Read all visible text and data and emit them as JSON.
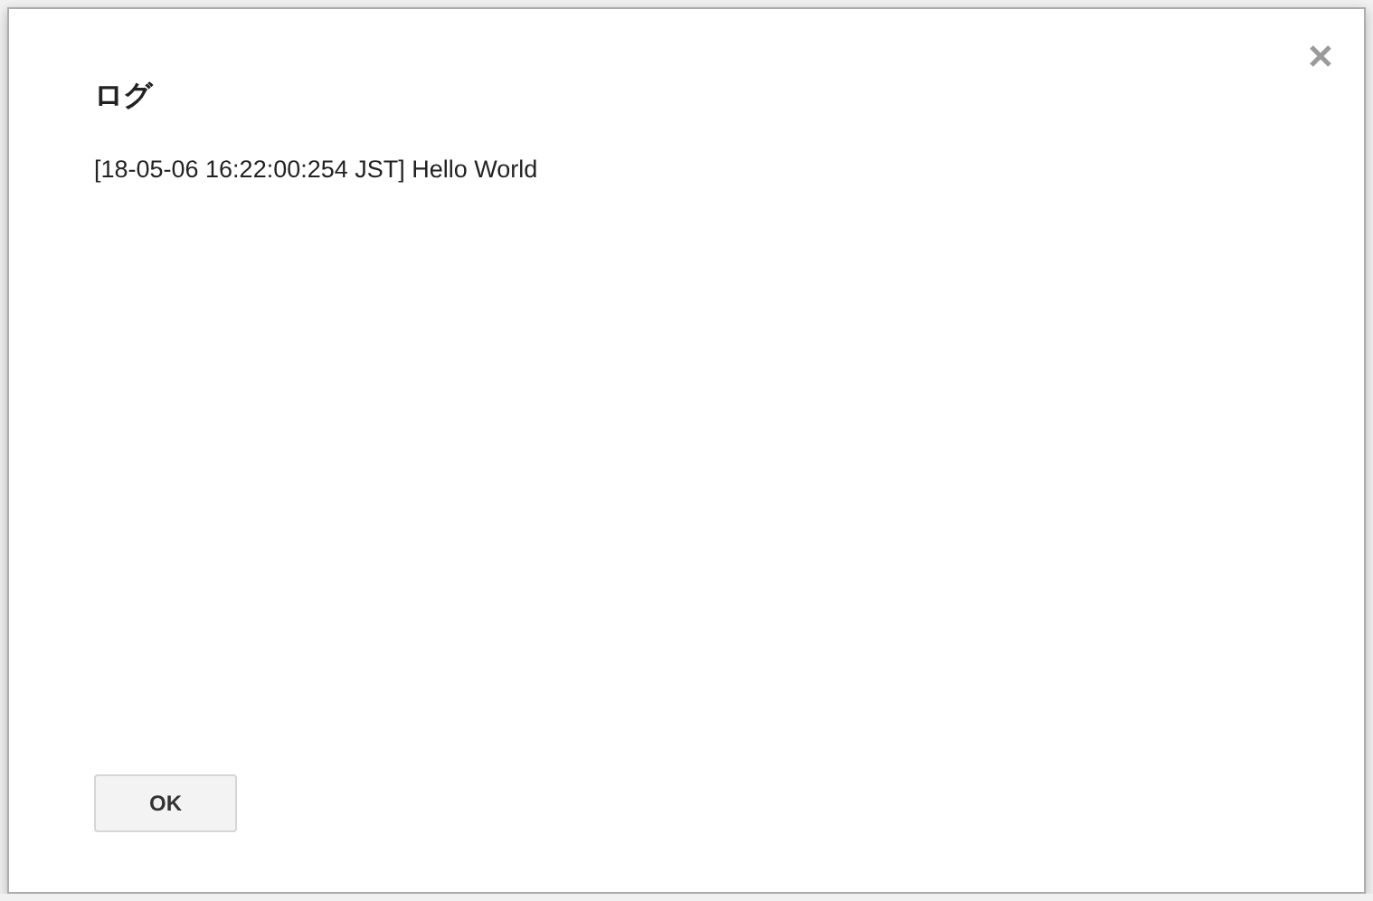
{
  "dialog": {
    "title": "ログ",
    "log_lines": [
      "[18-05-06 16:22:00:254 JST] Hello World"
    ],
    "buttons": [
      {
        "label": "OK"
      }
    ]
  }
}
